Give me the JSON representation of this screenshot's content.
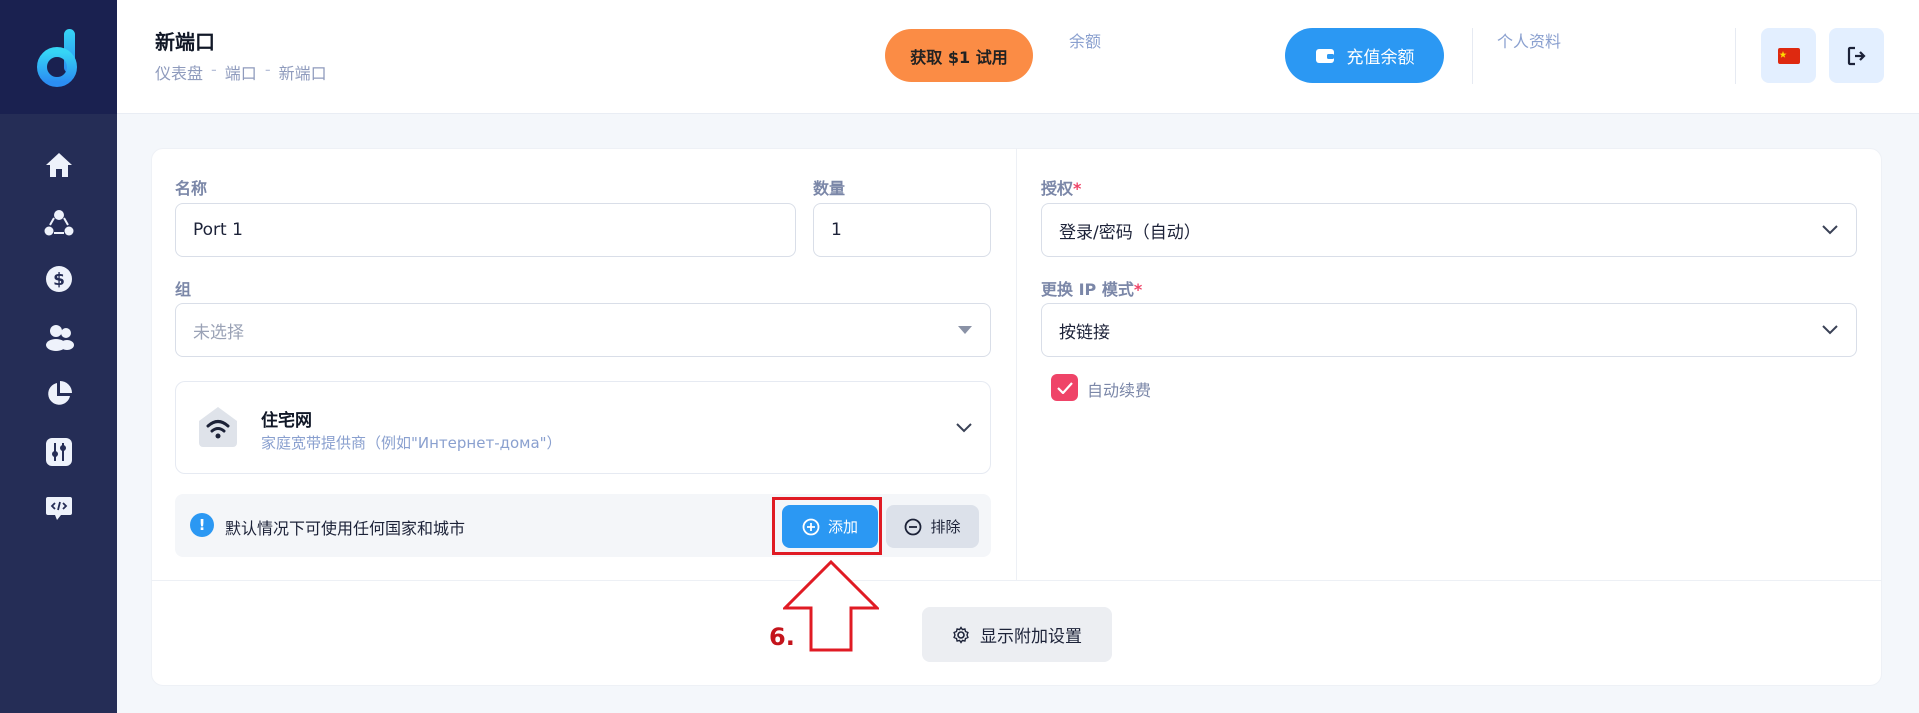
{
  "header": {
    "title": "新端口",
    "breadcrumb": [
      "仪表盘",
      "端口",
      "新端口"
    ],
    "breadcrumb_sep": "-",
    "trial_button": "获取 $1 试用",
    "balance_label": "余额",
    "topup_button": "充值余额",
    "profile_label": "个人资料"
  },
  "sidebar": {
    "items": [
      "home-icon",
      "network-icon",
      "dollar-icon",
      "users-icon",
      "pie-chart-icon",
      "sliders-icon",
      "code-chat-icon"
    ]
  },
  "form": {
    "name_label": "名称",
    "name_value": "Port 1",
    "qty_label": "数量",
    "qty_value": "1",
    "group_label": "组",
    "group_placeholder": "未选择",
    "auth_label": "授权",
    "auth_value": "登录/密码（自动）",
    "ip_mode_label": "更换 IP 模式",
    "ip_mode_value": "按链接",
    "auto_renew_label": "自动续费",
    "auto_renew_checked": true,
    "required_mark": "*"
  },
  "proxy_type": {
    "title": "住宅网",
    "subtitle": "家庭宽带提供商（例如\"Интернет-дома\"）"
  },
  "geo": {
    "info_text": "默认情况下可使用任何国家和城市",
    "add_button": "添加",
    "exclude_button": "排除"
  },
  "more_settings_button": "显示附加设置",
  "annotation": {
    "step_label": "6."
  },
  "colors": {
    "sidebar": "#252d56",
    "accent_blue": "#2b98f3",
    "orange": "#fb8c45",
    "checkbox": "#ef4468",
    "annotation_red": "#e01b24"
  }
}
